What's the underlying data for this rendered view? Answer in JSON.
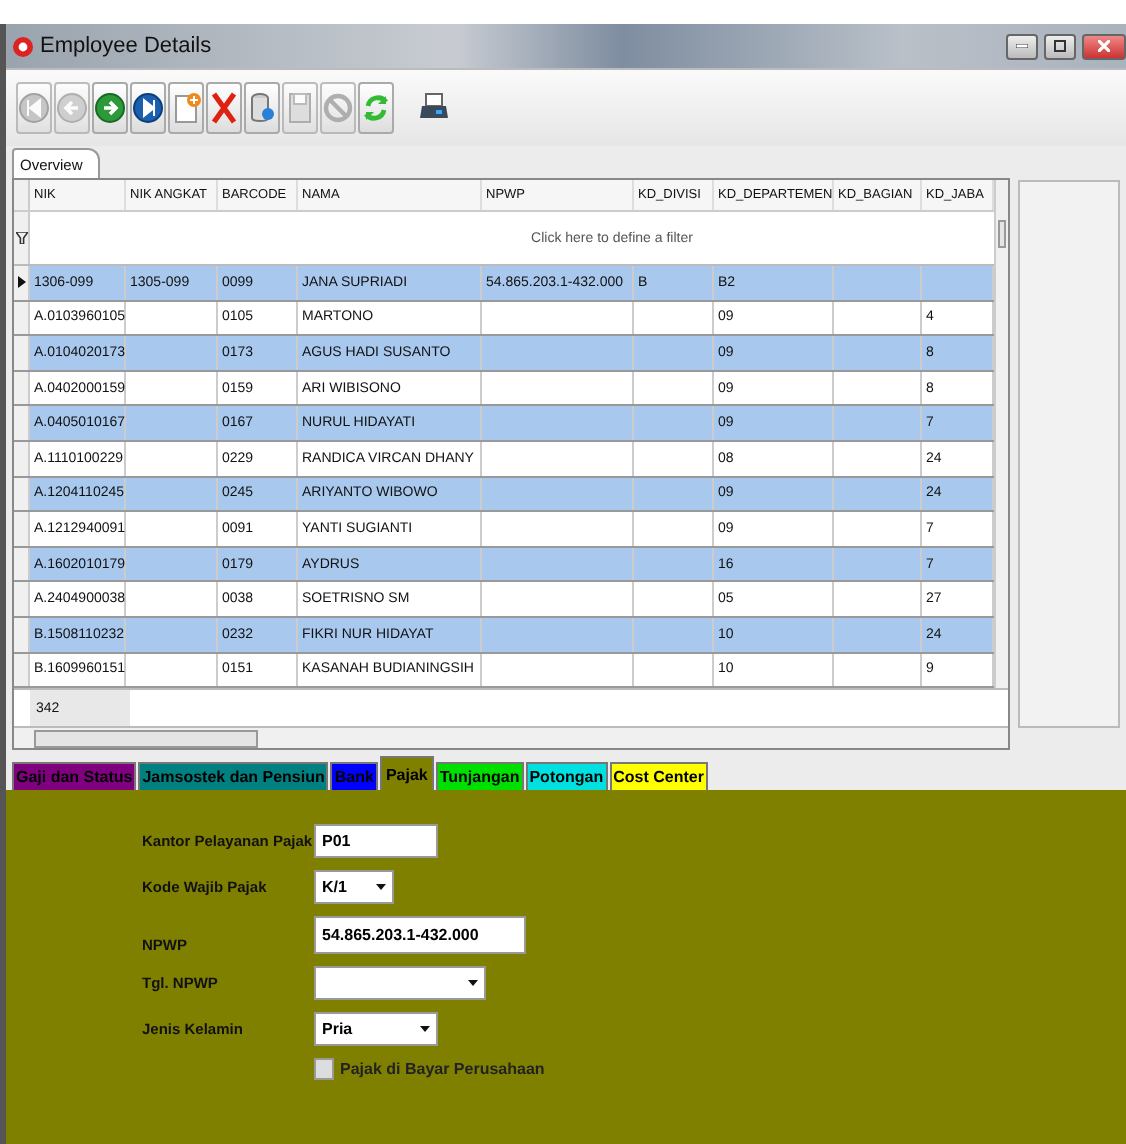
{
  "window": {
    "title": "Employee Details"
  },
  "toolbar": [
    {
      "kind": "first",
      "disabled": true
    },
    {
      "kind": "previous",
      "disabled": true
    },
    {
      "kind": "next",
      "disabled": false
    },
    {
      "kind": "last",
      "disabled": false
    },
    {
      "kind": "new",
      "disabled": false
    },
    {
      "kind": "delete",
      "disabled": false
    },
    {
      "kind": "database",
      "disabled": false
    },
    {
      "kind": "save",
      "disabled": true
    },
    {
      "kind": "cancel",
      "disabled": true
    },
    {
      "kind": "refresh",
      "disabled": false
    },
    {
      "kind": "print",
      "disabled": false
    }
  ],
  "view_tabs": [
    {
      "label": "Overview",
      "selected": true
    }
  ],
  "grid": {
    "columns": [
      "NIK",
      "NIK ANGKAT",
      "BARCODE",
      "NAMA",
      "NPWP",
      "KD_DIVISI",
      "KD_DEPARTEMEN",
      "KD_BAGIAN",
      "KD_JABA"
    ],
    "filter_hint": "Click here to define a filter",
    "rows": [
      {
        "selected": true,
        "cells": [
          "1306-099",
          "1305-099",
          "0099",
          "JANA SUPRIADI",
          "54.865.203.1-432.000",
          "B",
          "B2",
          "",
          ""
        ]
      },
      {
        "selected": false,
        "cells": [
          "A.0103960105",
          "",
          "0105",
          "MARTONO",
          "",
          "",
          "09",
          "",
          "4"
        ]
      },
      {
        "selected": false,
        "cells": [
          "A.0104020173",
          "",
          "0173",
          "AGUS HADI SUSANTO",
          "",
          "",
          "09",
          "",
          "8"
        ]
      },
      {
        "selected": false,
        "cells": [
          "A.0402000159",
          "",
          "0159",
          "ARI WIBISONO",
          "",
          "",
          "09",
          "",
          "8"
        ]
      },
      {
        "selected": false,
        "cells": [
          "A.0405010167",
          "",
          "0167",
          "NURUL HIDAYATI",
          "",
          "",
          "09",
          "",
          "7"
        ]
      },
      {
        "selected": false,
        "cells": [
          "A.1110100229",
          "",
          "0229",
          "RANDICA VIRCAN DHANY",
          "",
          "",
          "08",
          "",
          "24"
        ]
      },
      {
        "selected": false,
        "cells": [
          "A.1204110245",
          "",
          "0245",
          "ARIYANTO WIBOWO",
          "",
          "",
          "09",
          "",
          "24"
        ]
      },
      {
        "selected": false,
        "cells": [
          "A.1212940091",
          "",
          "0091",
          "YANTI SUGIANTI",
          "",
          "",
          "09",
          "",
          "7"
        ]
      },
      {
        "selected": false,
        "cells": [
          "A.1602010179",
          "",
          "0179",
          "AYDRUS",
          "",
          "",
          "16",
          "",
          "7"
        ]
      },
      {
        "selected": false,
        "cells": [
          "A.2404900038",
          "",
          "0038",
          "SOETRISNO SM",
          "",
          "",
          "05",
          "",
          "27"
        ]
      },
      {
        "selected": false,
        "cells": [
          "B.1508110232",
          "",
          "0232",
          "FIKRI NUR HIDAYAT",
          "",
          "",
          "10",
          "",
          "24"
        ]
      },
      {
        "selected": false,
        "cells": [
          "B.1609960151",
          "",
          "0151",
          "KASANAH BUDIANINGSIH",
          "",
          "",
          "10",
          "",
          "9"
        ]
      }
    ],
    "footer": "342"
  },
  "detail_tabs": [
    {
      "label": "Gaji dan Status",
      "color": "#800080",
      "selected": false
    },
    {
      "label": "Jamsostek dan Pensiun",
      "color": "#008080",
      "selected": false
    },
    {
      "label": "Bank",
      "color": "#0000ff",
      "selected": false
    },
    {
      "label": "Pajak",
      "color": "#808000",
      "selected": true
    },
    {
      "label": "Tunjangan",
      "color": "#00e000",
      "selected": false
    },
    {
      "label": "Potongan",
      "color": "#00e0e0",
      "selected": false
    },
    {
      "label": "Cost Center",
      "color": "#ffff00",
      "selected": false
    }
  ],
  "form": {
    "fields": [
      {
        "kind": "text",
        "label": "Kantor Pelayanan Pajak",
        "value": "P01"
      },
      {
        "kind": "select",
        "label": "Kode Wajib Pajak",
        "value": "K/1"
      },
      {
        "kind": "text",
        "label": "NPWP",
        "value": "54.865.203.1-432.000"
      },
      {
        "kind": "select",
        "label": "Tgl. NPWP"
      },
      {
        "kind": "select",
        "label": "Jenis Kelamin",
        "value": "Pria"
      },
      {
        "kind": "checkbox",
        "label": "Pajak di Bayar Perusahaan",
        "checked": false
      }
    ]
  }
}
